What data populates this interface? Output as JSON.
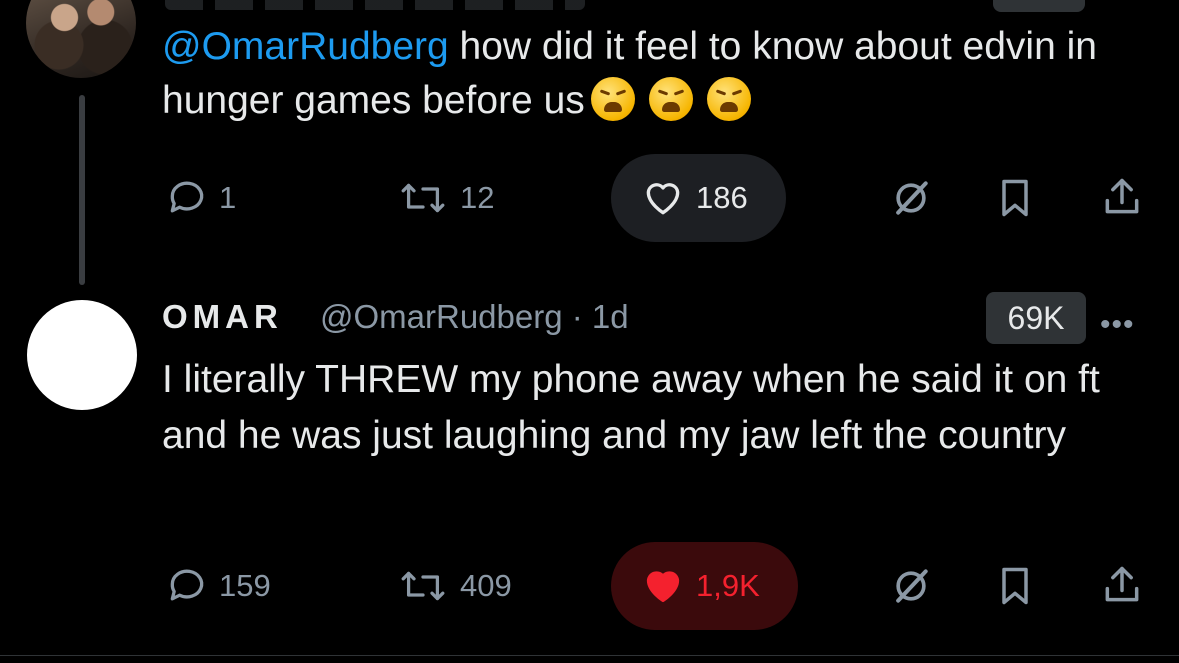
{
  "reply_tweet": {
    "mention": "@OmarRudberg",
    "text_rest": " how did it feel to know about edvin in hunger games before us",
    "emoji": [
      "weary-face-emoji",
      "weary-face-emoji",
      "weary-face-emoji"
    ],
    "actions": {
      "replies": "1",
      "retweets": "12",
      "likes": "186"
    }
  },
  "main_tweet": {
    "display_name": "OMAR",
    "handle_time": "@OmarRudberg · 1d",
    "views_badge": "69K",
    "more": "•••",
    "text": "I literally THREW my phone away when he said it on ft and he was just laughing and my jaw left the country",
    "actions": {
      "replies": "159",
      "retweets": "409",
      "likes": "1,9K"
    }
  },
  "colors": {
    "background": "#000000",
    "text": "#e7e9ea",
    "secondary": "#8b98a5",
    "link": "#1d9bf0",
    "like_active": "#f91880",
    "like_heart_red": "#f4212e"
  }
}
